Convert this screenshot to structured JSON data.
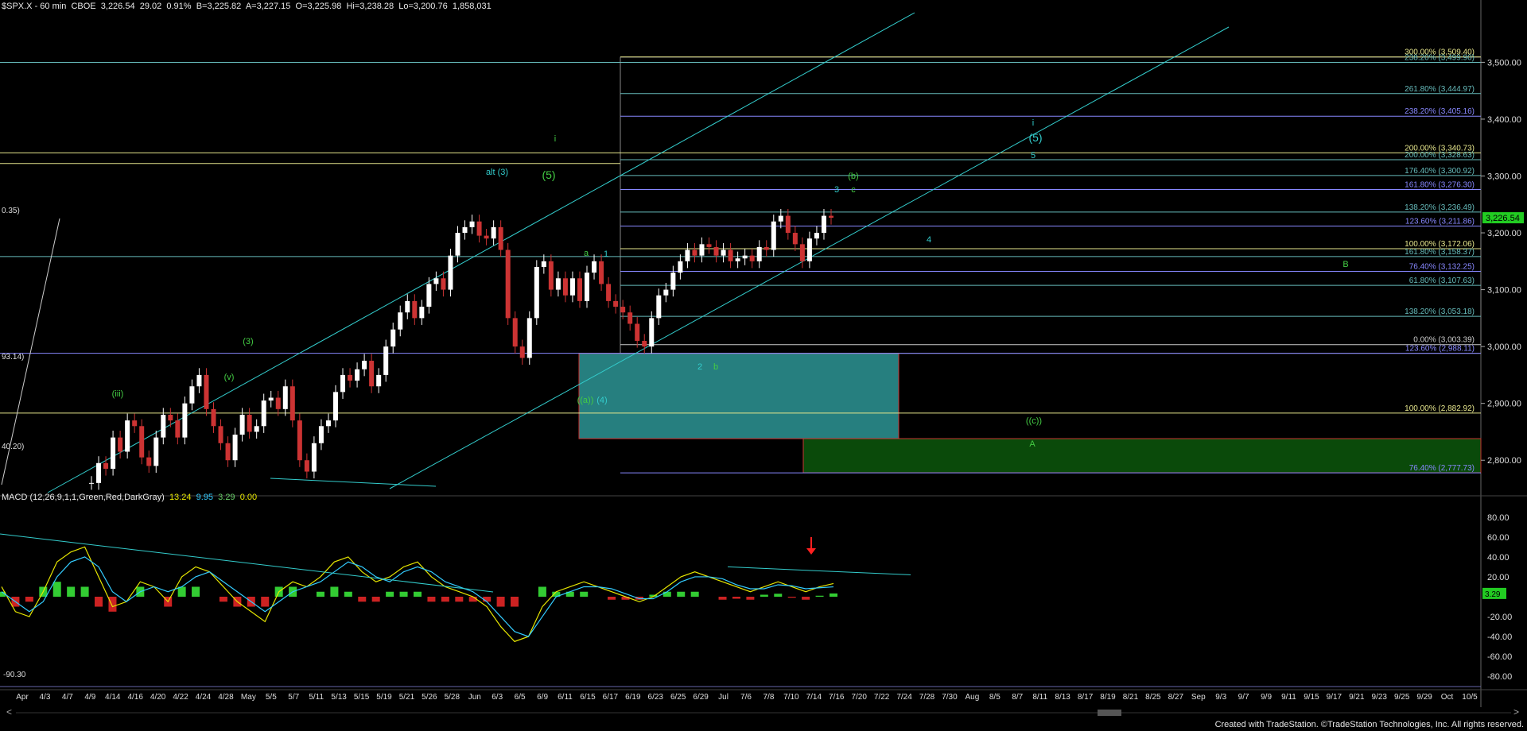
{
  "header": {
    "symbol": "$SPX.X - 60 min",
    "exchange": "CBOE",
    "last": "3,226.54",
    "change": "29.02",
    "change_pct": "0.91%",
    "bid": "B=3,225.82",
    "ask": "A=3,227.15",
    "open": "O=3,225.98",
    "high": "Hi=3,238.28",
    "low": "Lo=3,200.76",
    "volume": "1,858,031"
  },
  "macd_header": {
    "label": "MACD (12,26,9,1,1,Green,Red,DarkGray)",
    "values": [
      "13.24",
      "9.95",
      "3.29",
      "0.00"
    ],
    "colors": [
      "#e6e600",
      "#33ccff",
      "#66cc66",
      "#e6e600"
    ]
  },
  "credit": "Created with TradeStation. ©TradeStation Technologies, Inc. All rights reserved.",
  "colors": {
    "background": "#000000",
    "up_candle": "#ffffff",
    "channel": "#33cccc",
    "fib_blue": "#8888ff",
    "fib_yellow": "#e6e68c",
    "fib_teal": "#66bbbb",
    "target_box": "#33aaaa",
    "support_box": "#0a4a0a",
    "wave_green": "#44cc44",
    "wave_cyan": "#33cccc",
    "macd_pos": "#33cc33",
    "macd_neg": "#cc2222",
    "arrow": "#ff2020"
  },
  "chart_data": [
    {
      "type": "line",
      "title": "$SPX.X - 60 min",
      "y_axis": {
        "range": [
          2750,
          3590
        ],
        "ticks": [
          "3,500.00",
          "3,400.00",
          "3,300.00",
          "3,200.00",
          "3,100.00",
          "3,000.00",
          "2,900.00",
          "2,800.00"
        ],
        "tick_values": [
          3500,
          3400,
          3300,
          3200,
          3100,
          3000,
          2900,
          2800
        ]
      },
      "x_axis": {
        "ticks": [
          "Apr",
          "4/3",
          "4/7",
          "4/9",
          "4/14",
          "4/16",
          "4/20",
          "4/22",
          "4/24",
          "4/28",
          "May",
          "5/5",
          "5/7",
          "5/11",
          "5/13",
          "5/15",
          "5/19",
          "5/21",
          "5/26",
          "5/28",
          "Jun",
          "6/3",
          "6/5",
          "6/9",
          "6/11",
          "6/15",
          "6/17",
          "6/19",
          "6/23",
          "6/25",
          "6/29",
          "Jul",
          "7/6",
          "7/8",
          "7/10",
          "7/14",
          "7/16",
          "7/20",
          "7/22",
          "7/24",
          "7/28",
          "7/30",
          "Aug",
          "8/5",
          "8/7",
          "8/11",
          "8/13",
          "8/17",
          "8/19",
          "8/21",
          "8/25",
          "8/27",
          "Sep",
          "9/3",
          "9/7",
          "9/9",
          "9/11",
          "9/15",
          "9/17",
          "9/21",
          "9/23",
          "9/25",
          "9/29",
          "Oct",
          "10/5"
        ]
      },
      "series": [
        {
          "values": [
            2760,
            2795,
            2785,
            2840,
            2815,
            2870,
            2860,
            2805,
            2790,
            2840,
            2880,
            2870,
            2840,
            2900,
            2930,
            2950,
            2890,
            2860,
            2830,
            2800,
            2845,
            2880,
            2850,
            2860,
            2905,
            2910,
            2890,
            2930,
            2870,
            2800,
            2780,
            2830,
            2860,
            2870,
            2920,
            2950,
            2940,
            2960,
            2975,
            2930,
            2950,
            3000,
            3030,
            3060,
            3080,
            3050,
            3070,
            3110,
            3120,
            3100,
            3160,
            3200,
            3210,
            3220,
            3195,
            3190,
            3210,
            3170,
            3050,
            3000,
            2980,
            3050,
            3140,
            3150,
            3100,
            3120,
            3090,
            3120,
            3080,
            3130,
            3150,
            3110,
            3080,
            3070,
            3060,
            3040,
            3010,
            3000,
            3050,
            3090,
            3100,
            3130,
            3150,
            3170,
            3160,
            3180,
            3175,
            3160,
            3170,
            3150,
            3155,
            3160,
            3150,
            3175,
            3170,
            3220,
            3230,
            3200,
            3180,
            3150,
            3190,
            3200,
            3230,
            3226.54
          ]
        }
      ],
      "levels": [
        {
          "label": "300.00% (3,509.40)",
          "value": 3509.4,
          "color": "#e6e68c"
        },
        {
          "label": "238.20% (3,499.90)",
          "value": 3499.9,
          "color": "#66bbbb"
        },
        {
          "label": "261.80% (3,444.97)",
          "value": 3444.97,
          "color": "#66bbbb"
        },
        {
          "label": "238.20% (3,405.16)",
          "value": 3405.16,
          "color": "#8888ff"
        },
        {
          "label": "200.00% (3,340.73)",
          "value": 3340.73,
          "color": "#e6e68c"
        },
        {
          "label": "200.00% (3,328.63)",
          "value": 3328.63,
          "color": "#66bbbb"
        },
        {
          "label": "176.40% (3,300.92)",
          "value": 3300.92,
          "color": "#66bbbb"
        },
        {
          "label": "161.80% (3,276.30)",
          "value": 3276.3,
          "color": "#8888ff"
        },
        {
          "label": "138.20% (3,236.49)",
          "value": 3236.49,
          "color": "#66bbbb"
        },
        {
          "label": "123.60% (3,211.86)",
          "value": 3211.86,
          "color": "#8888ff"
        },
        {
          "label": "100.00% (3,172.06)",
          "value": 3172.06,
          "color": "#e6e68c"
        },
        {
          "label": "161.80% (3,158.37)",
          "value": 3158.37,
          "color": "#66bbbb"
        },
        {
          "label": "76.40% (3,132.25)",
          "value": 3132.25,
          "color": "#8888ff"
        },
        {
          "label": "61.80% (3,107.63)",
          "value": 3107.63,
          "color": "#66bbbb"
        },
        {
          "label": "138.20% (3,053.18)",
          "value": 3053.18,
          "color": "#66bbbb"
        },
        {
          "label": "0.00% (3,003.39)",
          "value": 3003.39,
          "color": "#cccccc"
        },
        {
          "label": "123.60% (2,988.11)",
          "value": 2988.11,
          "color": "#8888ff"
        },
        {
          "label": "100.00% (2,882.92)",
          "value": 2882.92,
          "color": "#e6e68c"
        },
        {
          "label": "76.40% (2,777.73)",
          "value": 2777.73,
          "color": "#8888ff"
        }
      ],
      "left_labels": [
        "0.35)",
        "93.14)",
        "40.20)"
      ],
      "last_price_tag": "3,226.54",
      "wave_labels": [
        {
          "text": "(iii)",
          "color": "#44cc44"
        },
        {
          "text": "(3)",
          "color": "#44cc44"
        },
        {
          "text": "(v)",
          "color": "#44cc44"
        },
        {
          "text": "i",
          "color": "#44cc44"
        },
        {
          "text": "(5)",
          "color": "#44cc44"
        },
        {
          "text": "alt (3)",
          "color": "#33cccc"
        },
        {
          "text": "a",
          "color": "#44cc44"
        },
        {
          "text": "1",
          "color": "#33cccc"
        },
        {
          "text": "((a))",
          "color": "#44cc44"
        },
        {
          "text": "(4)",
          "color": "#33cccc"
        },
        {
          "text": "2",
          "color": "#33cccc"
        },
        {
          "text": "b",
          "color": "#44cc44"
        },
        {
          "text": "3",
          "color": "#33cccc"
        },
        {
          "text": "c",
          "color": "#44cc44"
        },
        {
          "text": "(b)",
          "color": "#44cc44"
        },
        {
          "text": "4",
          "color": "#33cccc"
        },
        {
          "text": "i",
          "color": "#33cccc"
        },
        {
          "text": "(5)",
          "color": "#33cccc"
        },
        {
          "text": "5",
          "color": "#33cccc"
        },
        {
          "text": "B",
          "color": "#44cc44"
        },
        {
          "text": "((c))",
          "color": "#44cc44"
        },
        {
          "text": "A",
          "color": "#44cc44"
        }
      ]
    },
    {
      "type": "line",
      "title": "MACD (12,26,9,1,1,Green,Red,DarkGray)",
      "y_axis": {
        "range": [
          -95,
          95
        ],
        "ticks": [
          "80.00",
          "60.00",
          "40.00",
          "20.00",
          "-20.00",
          "-40.00",
          "-60.00",
          "-80.00"
        ],
        "tick_values": [
          80,
          60,
          40,
          20,
          -20,
          -40,
          -60,
          -80
        ]
      },
      "left_label": "-90.30",
      "last_value_tag": "3.29",
      "series": [
        {
          "name": "MACD",
          "values": [
            10,
            -15,
            -20,
            5,
            35,
            45,
            50,
            20,
            -10,
            -5,
            15,
            10,
            -5,
            20,
            30,
            25,
            10,
            -5,
            -15,
            -25,
            5,
            15,
            10,
            20,
            35,
            40,
            25,
            15,
            20,
            30,
            35,
            20,
            10,
            5,
            0,
            -10,
            -30,
            -45,
            -40,
            -10,
            5,
            10,
            15,
            10,
            5,
            0,
            -5,
            0,
            10,
            20,
            25,
            20,
            15,
            10,
            5,
            10,
            15,
            10,
            5,
            10,
            13.24
          ]
        },
        {
          "name": "Signal",
          "values": [
            5,
            -5,
            -15,
            -5,
            20,
            35,
            40,
            30,
            5,
            -5,
            5,
            10,
            5,
            10,
            20,
            25,
            15,
            5,
            -5,
            -15,
            -5,
            5,
            10,
            15,
            25,
            35,
            30,
            20,
            15,
            25,
            30,
            25,
            15,
            10,
            5,
            -5,
            -20,
            -35,
            -40,
            -20,
            0,
            5,
            10,
            10,
            8,
            3,
            -2,
            -2,
            5,
            15,
            20,
            20,
            18,
            12,
            8,
            8,
            12,
            11,
            8,
            9,
            9.95
          ]
        }
      ]
    }
  ]
}
